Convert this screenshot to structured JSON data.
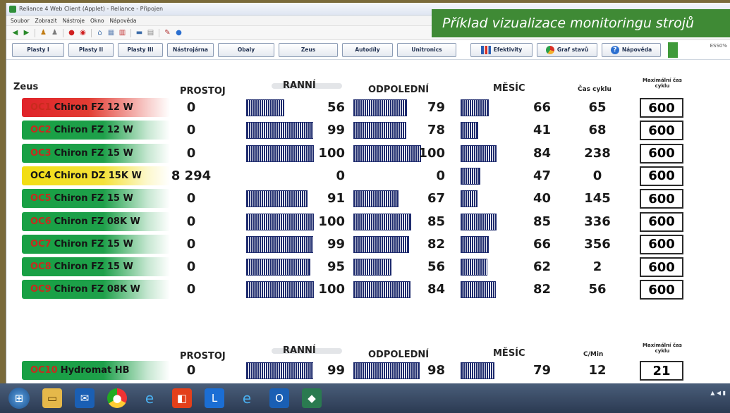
{
  "window": {
    "title": "Reliance 4 Web Client (Applet) - Reliance - Připojen",
    "menu": [
      "Soubor",
      "Zobrazit",
      "Nástroje",
      "Okno",
      "Nápověda"
    ],
    "zoom_readout": "ESS0%"
  },
  "banner": {
    "text": "Příklad vizualizace monitoringu strojů"
  },
  "nav": {
    "buttons": [
      "Plasty I",
      "Plasty II",
      "Plasty III",
      "Nástrojárna",
      "Obaly",
      "Zeus",
      "Autodíly",
      "Unitronics"
    ],
    "right_buttons": [
      "Efektivity",
      "Graf stavů",
      "Nápověda"
    ]
  },
  "section": {
    "title": "Zeus"
  },
  "headers": {
    "prostoj": "PROSTOJ",
    "ranni": "RANNÍ",
    "odpoledni": "ODPOLEDNÍ",
    "mesic": "MĚSÍC",
    "cas_cyklu": "Čas cyklu",
    "max_cyklu": "Maximální čas cyklu"
  },
  "headers2": {
    "prostoj": "PROSTOJ",
    "ranni": "RANNÍ",
    "odpoledni": "ODPOLEDNÍ",
    "mesic": "MĚSÍC",
    "cmin": "C/Min",
    "max_cyklu": "Maximální čas cyklu"
  },
  "colors": {
    "running": "#1ea04a",
    "stopped": "#e0232a",
    "warning": "#f2dd12",
    "bar": "#1f2c6e",
    "banner": "#3f8a35"
  },
  "machines": [
    {
      "code": "OC1",
      "name": "Chiron FZ 12 W",
      "status": "red",
      "prostoj": "0",
      "ranni": "56",
      "odpoledni": "79",
      "mesic": "66",
      "cyklus": "65",
      "max": "600"
    },
    {
      "code": "OC2",
      "name": "Chiron FZ 12 W",
      "status": "green",
      "prostoj": "0",
      "ranni": "99",
      "odpoledni": "78",
      "mesic": "41",
      "cyklus": "68",
      "max": "600"
    },
    {
      "code": "OC3",
      "name": "Chiron FZ 15 W",
      "status": "green",
      "prostoj": "0",
      "ranni": "100",
      "odpoledni": "100",
      "mesic": "84",
      "cyklus": "238",
      "max": "600"
    },
    {
      "code": "OC4",
      "name": "Chiron DZ 15K W",
      "status": "yellow",
      "prostoj": "8 294",
      "ranni": "0",
      "odpoledni": "0",
      "mesic": "47",
      "cyklus": "0",
      "max": "600"
    },
    {
      "code": "OC5",
      "name": "Chiron FZ 15 W",
      "status": "green",
      "prostoj": "0",
      "ranni": "91",
      "odpoledni": "67",
      "mesic": "40",
      "cyklus": "145",
      "max": "600"
    },
    {
      "code": "OC6",
      "name": "Chiron FZ 08K W",
      "status": "green",
      "prostoj": "0",
      "ranni": "100",
      "odpoledni": "85",
      "mesic": "85",
      "cyklus": "336",
      "max": "600"
    },
    {
      "code": "OC7",
      "name": "Chiron FZ 15 W",
      "status": "green",
      "prostoj": "0",
      "ranni": "99",
      "odpoledni": "82",
      "mesic": "66",
      "cyklus": "356",
      "max": "600"
    },
    {
      "code": "OC8",
      "name": "Chiron FZ 15 W",
      "status": "green",
      "prostoj": "0",
      "ranni": "95",
      "odpoledni": "56",
      "mesic": "62",
      "cyklus": "2",
      "max": "600"
    },
    {
      "code": "OC9",
      "name": "Chiron FZ 08K W",
      "status": "green",
      "prostoj": "0",
      "ranni": "100",
      "odpoledni": "84",
      "mesic": "82",
      "cyklus": "56",
      "max": "600"
    }
  ],
  "machine2": {
    "code": "OC10",
    "name": "Hydromat HB",
    "status": "green",
    "prostoj": "0",
    "ranni": "99",
    "odpoledni": "98",
    "mesic": "79",
    "cmin": "12",
    "max": "21"
  },
  "taskbar": {
    "apps": [
      "windows-start",
      "explorer",
      "outlook",
      "chrome",
      "ie",
      "office",
      "lync",
      "ie2",
      "outlook2",
      "reliance"
    ]
  }
}
